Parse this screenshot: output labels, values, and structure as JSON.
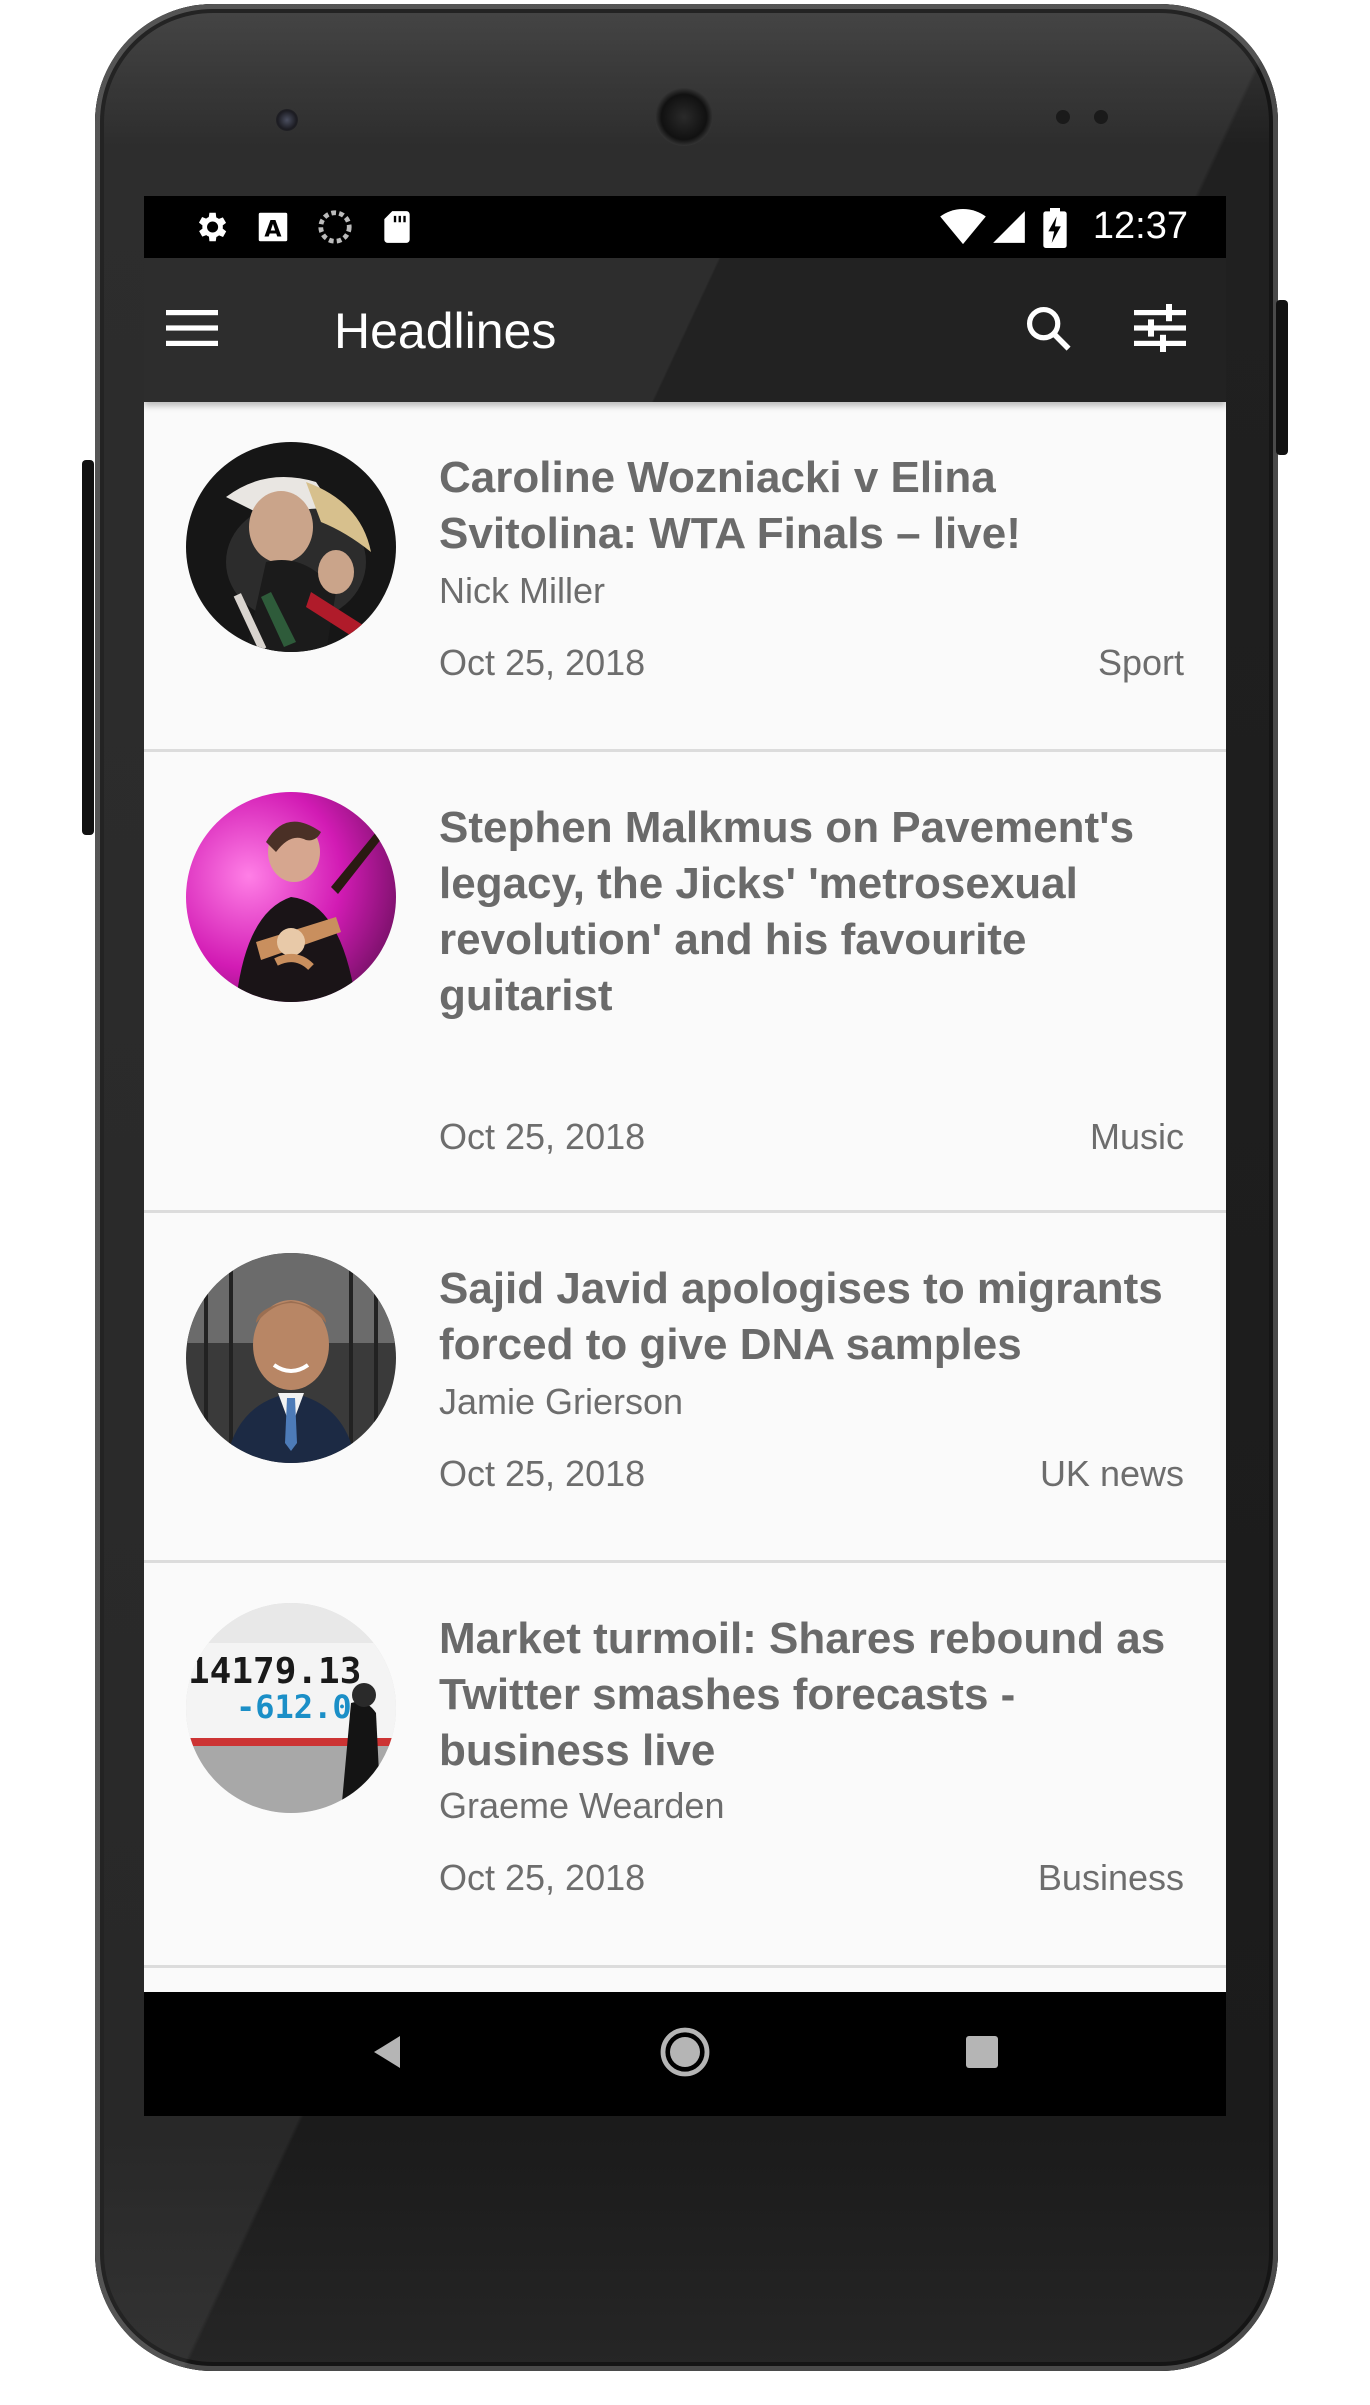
{
  "status_bar": {
    "time": "12:37",
    "icons_left": [
      "settings-icon",
      "a-badge-icon",
      "sync-icon",
      "sd-card-icon"
    ],
    "icons_right": [
      "wifi-icon",
      "signal-icon",
      "battery-charging-icon"
    ]
  },
  "toolbar": {
    "title": "Headlines",
    "menu_icon": "hamburger-icon",
    "search_icon": "search-icon",
    "filter_icon": "sliders-icon"
  },
  "articles": [
    {
      "headline": "Caroline Wozniacki v Elina Svitolina: WTA Finals – live!",
      "author": "Nick Miller",
      "date": "Oct 25, 2018",
      "section": "Sport"
    },
    {
      "headline": "Stephen Malkmus on Pavement's legacy, the Jicks' 'metrosexual revolution' and his favourite guitarist",
      "author": "",
      "date": "Oct 25, 2018",
      "section": "Music"
    },
    {
      "headline": "Sajid Javid apologises to migrants forced to give DNA samples",
      "author": "Jamie Grierson",
      "date": "Oct 25, 2018",
      "section": "UK news"
    },
    {
      "headline": "Market turmoil: Shares rebound as Twitter smashes forecasts - business live",
      "author": "Graeme Wearden",
      "date": "Oct 25, 2018",
      "section": "Business",
      "thumb_text_1": "14179.13",
      "thumb_text_2": "-612.0"
    }
  ],
  "nav_bar": {
    "icons": [
      "back-icon",
      "home-icon",
      "recents-icon"
    ]
  },
  "colors": {
    "toolbar": "#2d2d2d",
    "text": "#6a6a6a",
    "divider": "#dcdcdc",
    "screen_bg": "#fafafa"
  }
}
